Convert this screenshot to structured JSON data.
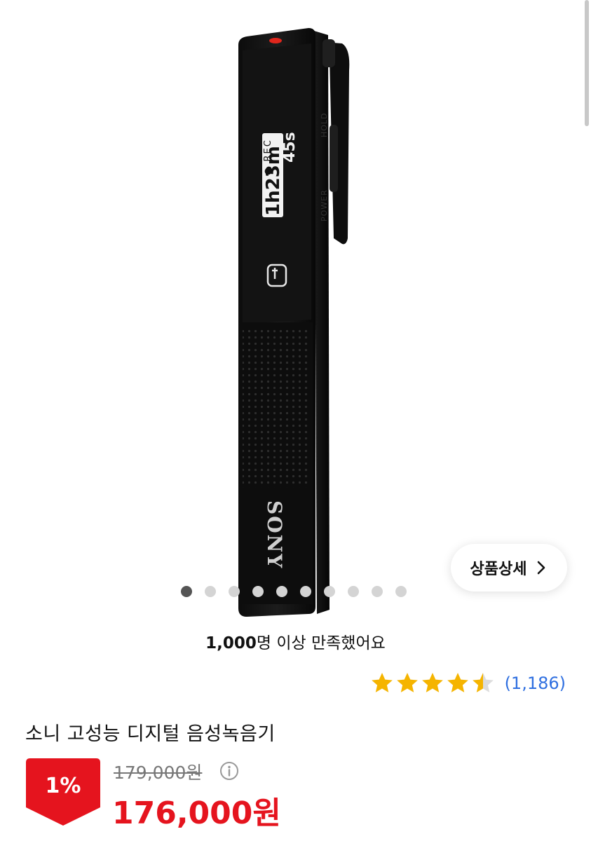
{
  "product": {
    "image_alt": "SONY",
    "device_screen": {
      "status": "REC",
      "time_h": "1",
      "time_m": "23",
      "time_s": "45",
      "switch_top": "HOLD",
      "switch_bottom": "POWER"
    }
  },
  "detail_button": {
    "label": "상품상세",
    "icon": "chevron-right-icon"
  },
  "carousel": {
    "total": 10,
    "active_index": 0
  },
  "satisfaction": {
    "bold": "1,000",
    "text": "명 이상 만족했어요"
  },
  "rating": {
    "value": 4.5,
    "max": 5,
    "count_label": "(1,186)",
    "star_color": "#f5b400"
  },
  "title": "소니 고성능 디지털 음성녹음기",
  "pricing": {
    "discount": "1%",
    "original": "179,000원",
    "sale": "176,000원",
    "sale_color": "#e5141e",
    "info_icon": "info-icon"
  }
}
